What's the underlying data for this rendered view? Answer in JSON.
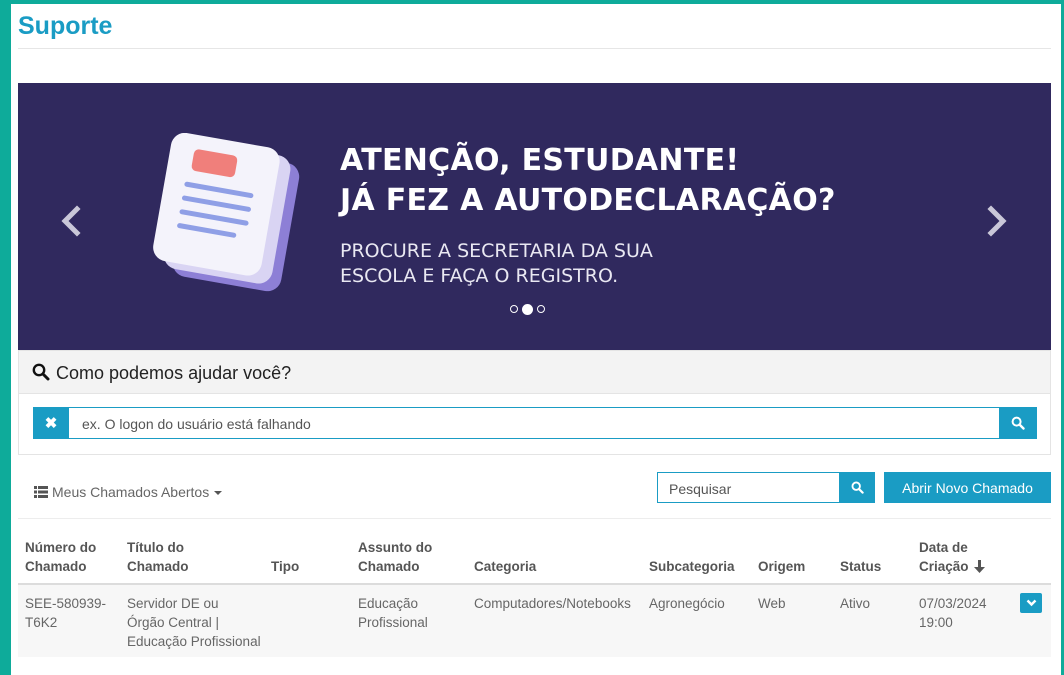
{
  "page": {
    "title": "Suporte"
  },
  "banner": {
    "headline_line1": "ATENÇÃO, ESTUDANTE!",
    "headline_line2": "JÁ FEZ A AUTODECLARAÇÃO?",
    "subtext_line1": "PROCURE A SECRETARIA DA SUA",
    "subtext_line2": "ESCOLA E FAÇA O REGISTRO.",
    "slide_count": 3,
    "active_slide": 2,
    "colors": {
      "background": "#30295e"
    }
  },
  "help": {
    "heading": "Como podemos ajudar você?",
    "placeholder": "ex. O logon do usuário está falhando"
  },
  "toolbar": {
    "view_label": "Meus Chamados Abertos",
    "search_placeholder": "Pesquisar",
    "new_ticket_label": "Abrir Novo Chamado"
  },
  "table": {
    "headers": {
      "numero_l1": "Número do",
      "numero_l2": "Chamado",
      "titulo_l1": "Título do",
      "titulo_l2": "Chamado",
      "tipo": "Tipo",
      "assunto_l1": "Assunto do",
      "assunto_l2": "Chamado",
      "categoria": "Categoria",
      "subcategoria": "Subcategoria",
      "origem": "Origem",
      "status": "Status",
      "data_l1": "Data de",
      "data_l2": "Criação"
    },
    "rows": [
      {
        "numero_l1": "SEE-580939-",
        "numero_l2": "T6K2",
        "titulo_l1": "Servidor DE ou",
        "titulo_l2": "Órgão Central |",
        "titulo_l3": "Educação Profissional",
        "tipo": "",
        "assunto_l1": "Educação",
        "assunto_l2": "Profissional",
        "categoria": "Computadores/Notebooks",
        "subcategoria": "Agronegócio",
        "origem": "Web",
        "status": "Ativo",
        "data_l1": "07/03/2024",
        "data_l2": "19:00"
      }
    ]
  },
  "colors": {
    "accent": "#1a9cc4",
    "frame": "#0eab9a"
  }
}
